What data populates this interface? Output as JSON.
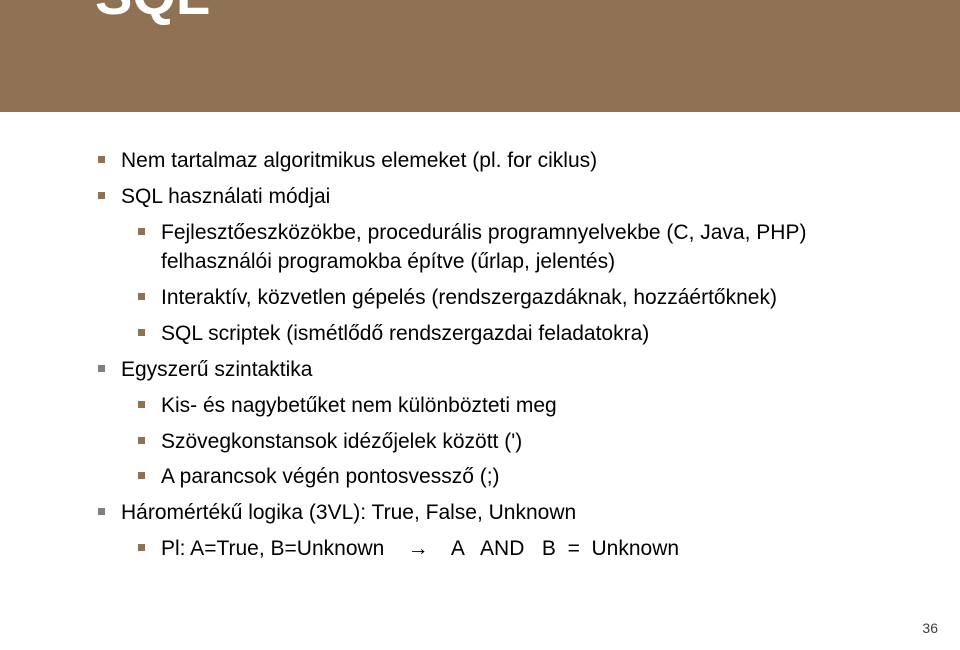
{
  "title": "SQL",
  "content": {
    "line1": "Nem tartalmaz algoritmikus elemeket (pl. for ciklus)",
    "line2": "SQL használati módjai",
    "line3": "Fejlesztőeszközökbe, procedurális programnyelvekbe (C, Java, PHP) felhasználói programokba építve (űrlap, jelentés)",
    "line4": "Interaktív, közvetlen gépelés (rendszergazdáknak, hozzáértőknek)",
    "line5": "SQL scriptek (ismétlődő rendszergazdai feladatokra)",
    "line6": "Egyszerű szintaktika",
    "line7": "Kis- és nagybetűket nem különbözteti meg",
    "line8": "Szövegkonstansok idézőjelek között (')",
    "line9": "A parancsok végén pontosvessző (;)",
    "line10": "Háromértékű logika (3VL): True, False, Unknown",
    "line11": "Pl: A=True, B=Unknown    →    A   AND   B  =  Unknown"
  },
  "pageNumber": "36"
}
